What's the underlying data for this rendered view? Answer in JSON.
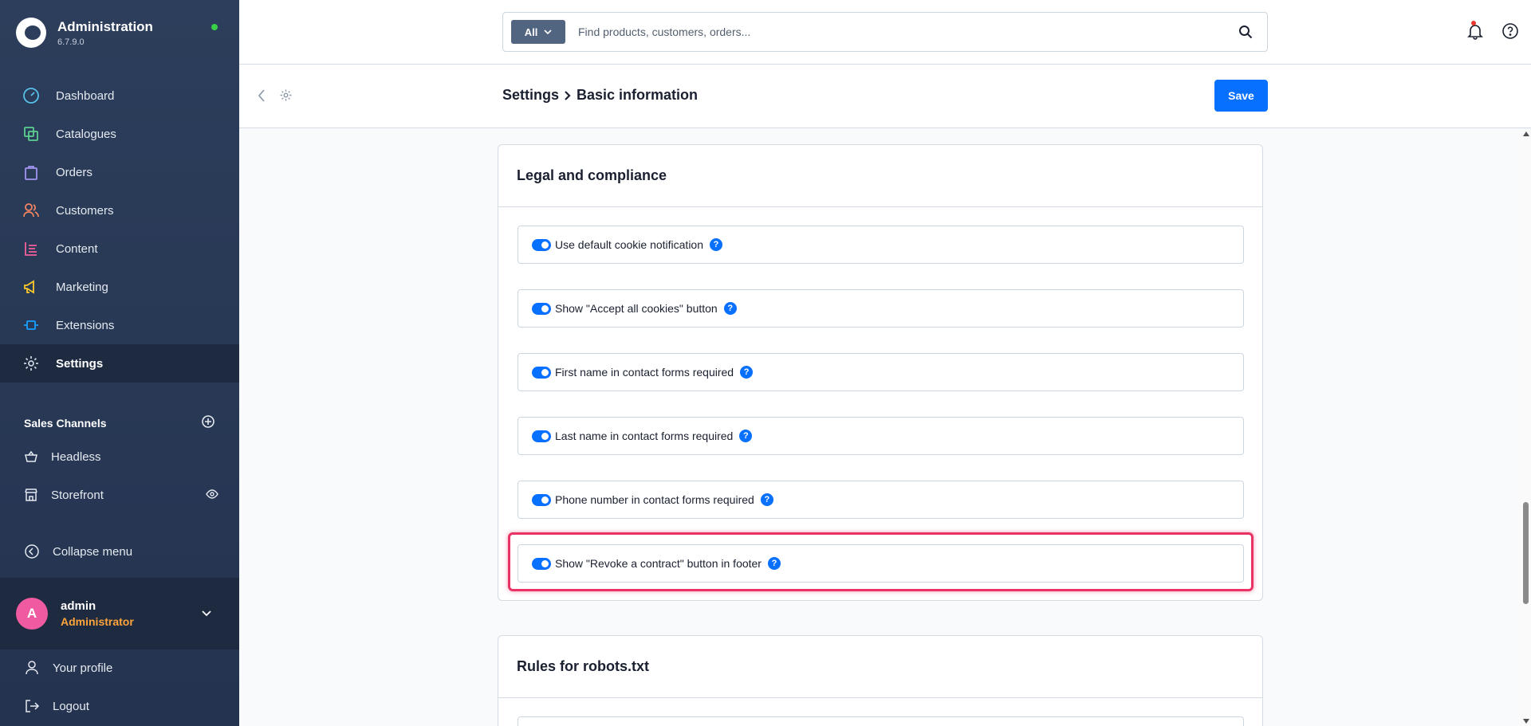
{
  "app": {
    "title": "Administration",
    "version": "6.7.9.0",
    "status_color": "#37d046"
  },
  "nav": {
    "items": [
      {
        "label": "Dashboard",
        "icon": "dashboard-icon",
        "color": "#57c0e8"
      },
      {
        "label": "Catalogues",
        "icon": "catalogue-icon",
        "color": "#5ccf8f"
      },
      {
        "label": "Orders",
        "icon": "orders-icon",
        "color": "#a294f0"
      },
      {
        "label": "Customers",
        "icon": "customers-icon",
        "color": "#f4845f"
      },
      {
        "label": "Content",
        "icon": "content-icon",
        "color": "#f25f9b"
      },
      {
        "label": "Marketing",
        "icon": "marketing-icon",
        "color": "#ffc928"
      },
      {
        "label": "Extensions",
        "icon": "extensions-icon",
        "color": "#189eff"
      },
      {
        "label": "Settings",
        "icon": "settings-icon",
        "color": "#c7cfdb",
        "active": true
      }
    ]
  },
  "sales_channels": {
    "title": "Sales Channels",
    "items": [
      {
        "label": "Headless",
        "icon": "basket-icon"
      },
      {
        "label": "Storefront",
        "icon": "storefront-icon"
      }
    ]
  },
  "collapse_label": "Collapse menu",
  "user": {
    "initial": "A",
    "name": "admin",
    "role": "Administrator"
  },
  "bottom": {
    "profile_label": "Your profile",
    "logout_label": "Logout"
  },
  "search": {
    "type_label": "All",
    "placeholder": "Find products, customers, orders...",
    "value": ""
  },
  "smartbar": {
    "breadcrumb_parent": "Settings",
    "breadcrumb_current": "Basic information",
    "save_label": "Save"
  },
  "legal_card": {
    "title": "Legal and compliance",
    "switches": [
      {
        "label": "Use default cookie notification",
        "checked": true
      },
      {
        "label": "Show \"Accept all cookies\" button",
        "checked": true
      },
      {
        "label": "First name in contact forms required",
        "checked": true
      },
      {
        "label": "Last name in contact forms required",
        "checked": true
      },
      {
        "label": "Phone number in contact forms required",
        "checked": true
      },
      {
        "label": "Show \"Revoke a contract\" button in footer",
        "checked": true
      }
    ]
  },
  "robots_card": {
    "title": "Rules for robots.txt"
  },
  "colors": {
    "accent": "#0870ff",
    "highlight": "#ea3365",
    "sidebar": "#2c3e5b",
    "role": "#ffa43a",
    "avatar": "#ef5aa0"
  }
}
